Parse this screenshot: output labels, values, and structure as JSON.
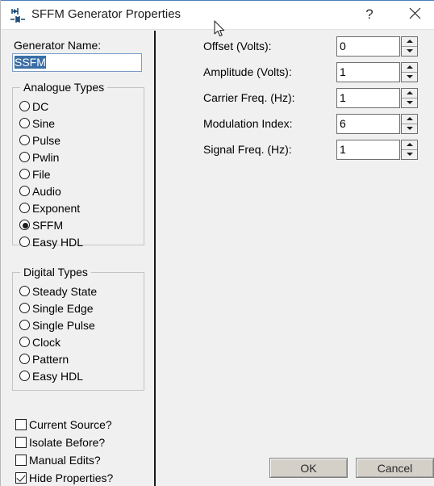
{
  "window": {
    "title": "SFFM Generator Properties",
    "icon": "generator-circuit-icon",
    "help_label": "?",
    "close_label": "✕"
  },
  "left_pane": {
    "generator_name": {
      "label": "Generator Name:",
      "value": "SSFM",
      "selected": true
    },
    "analogue_group": {
      "title": "Analogue Types",
      "options": [
        {
          "label": "DC",
          "checked": false
        },
        {
          "label": "Sine",
          "checked": false
        },
        {
          "label": "Pulse",
          "checked": false
        },
        {
          "label": "Pwlin",
          "checked": false
        },
        {
          "label": "File",
          "checked": false
        },
        {
          "label": "Audio",
          "checked": false
        },
        {
          "label": "Exponent",
          "checked": false
        },
        {
          "label": "SFFM",
          "checked": true
        },
        {
          "label": "Easy HDL",
          "checked": false
        }
      ]
    },
    "digital_group": {
      "title": "Digital Types",
      "options": [
        {
          "label": "Steady State",
          "checked": false
        },
        {
          "label": "Single Edge",
          "checked": false
        },
        {
          "label": "Single Pulse",
          "checked": false
        },
        {
          "label": "Clock",
          "checked": false
        },
        {
          "label": "Pattern",
          "checked": false
        },
        {
          "label": "Easy HDL",
          "checked": false
        }
      ]
    },
    "checkboxes": [
      {
        "label": "Current Source?",
        "checked": false
      },
      {
        "label": "Isolate Before?",
        "checked": false
      },
      {
        "label": "Manual Edits?",
        "checked": false
      },
      {
        "label": "Hide Properties?",
        "checked": true
      }
    ]
  },
  "right_pane": {
    "fields": [
      {
        "label": "Offset (Volts):",
        "value": "0"
      },
      {
        "label": "Amplitude (Volts):",
        "value": "1"
      },
      {
        "label": "Carrier Freq. (Hz):",
        "value": "1"
      },
      {
        "label": "Modulation Index:",
        "value": "6"
      },
      {
        "label": "Signal Freq. (Hz):",
        "value": "1"
      }
    ]
  },
  "footer": {
    "ok_label": "OK",
    "cancel_label": "Cancel"
  },
  "colors": {
    "dialog_bg": "#f0f0f0",
    "titlebar_bg": "#ffffff",
    "selection_blue": "#3a6ea5",
    "button_face": "#d4d0c8",
    "divider": "#1a1a1a"
  }
}
